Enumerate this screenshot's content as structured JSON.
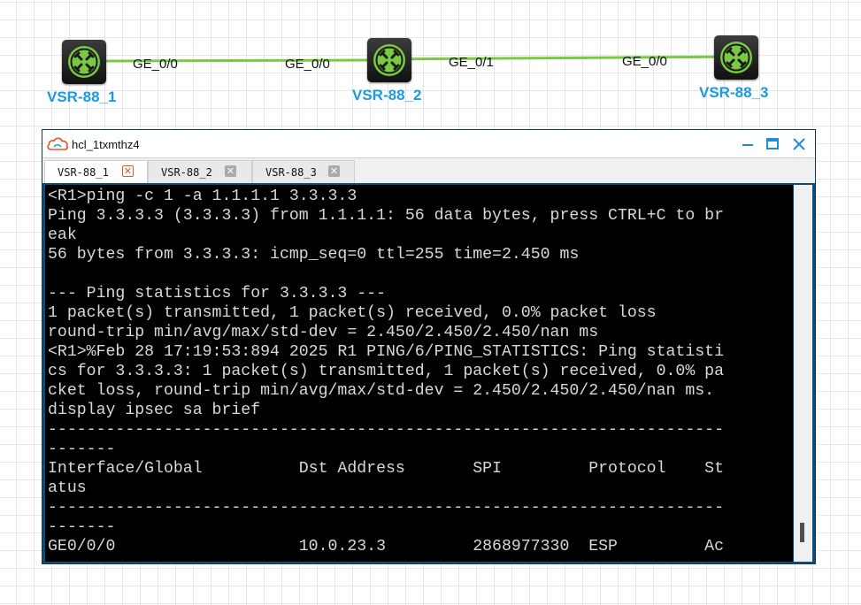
{
  "topology": {
    "nodes": [
      {
        "name": "VSR-88_1"
      },
      {
        "name": "VSR-88_2"
      },
      {
        "name": "VSR-88_3"
      }
    ],
    "ports": [
      "GE_0/0",
      "GE_0/0",
      "GE_0/1",
      "GE_0/0"
    ],
    "link_color": "#7ac943",
    "label_color": "#1a9be0"
  },
  "window": {
    "title": "hcl_1txmthz4",
    "icon": "cloud-icon",
    "buttons": [
      "minimize-icon",
      "maximize-icon",
      "close-icon"
    ],
    "accent": "#1f8dd6"
  },
  "tabs": [
    {
      "label": "VSR-88_1",
      "active": true
    },
    {
      "label": "VSR-88_2",
      "active": false
    },
    {
      "label": "VSR-88_3",
      "active": false
    }
  ],
  "terminal": {
    "lines": [
      "<R1>ping -c 1 -a 1.1.1.1 3.3.3.3",
      "Ping 3.3.3.3 (3.3.3.3) from 1.1.1.1: 56 data bytes, press CTRL+C to br",
      "eak",
      "56 bytes from 3.3.3.3: icmp_seq=0 ttl=255 time=2.450 ms",
      "",
      "--- Ping statistics for 3.3.3.3 ---",
      "1 packet(s) transmitted, 1 packet(s) received, 0.0% packet loss",
      "round-trip min/avg/max/std-dev = 2.450/2.450/2.450/nan ms",
      "<R1>%Feb 28 17:19:53:894 2025 R1 PING/6/PING_STATISTICS: Ping statisti",
      "cs for 3.3.3.3: 1 packet(s) transmitted, 1 packet(s) received, 0.0% pa",
      "cket loss, round-trip min/avg/max/std-dev = 2.450/2.450/2.450/nan ms.",
      "display ipsec sa brief",
      "----------------------------------------------------------------------",
      "-------",
      "Interface/Global          Dst Address       SPI         Protocol    St",
      "atus",
      "----------------------------------------------------------------------",
      "-------",
      "GE0/0/0                   10.0.23.3         2868977330  ESP         Ac"
    ]
  }
}
